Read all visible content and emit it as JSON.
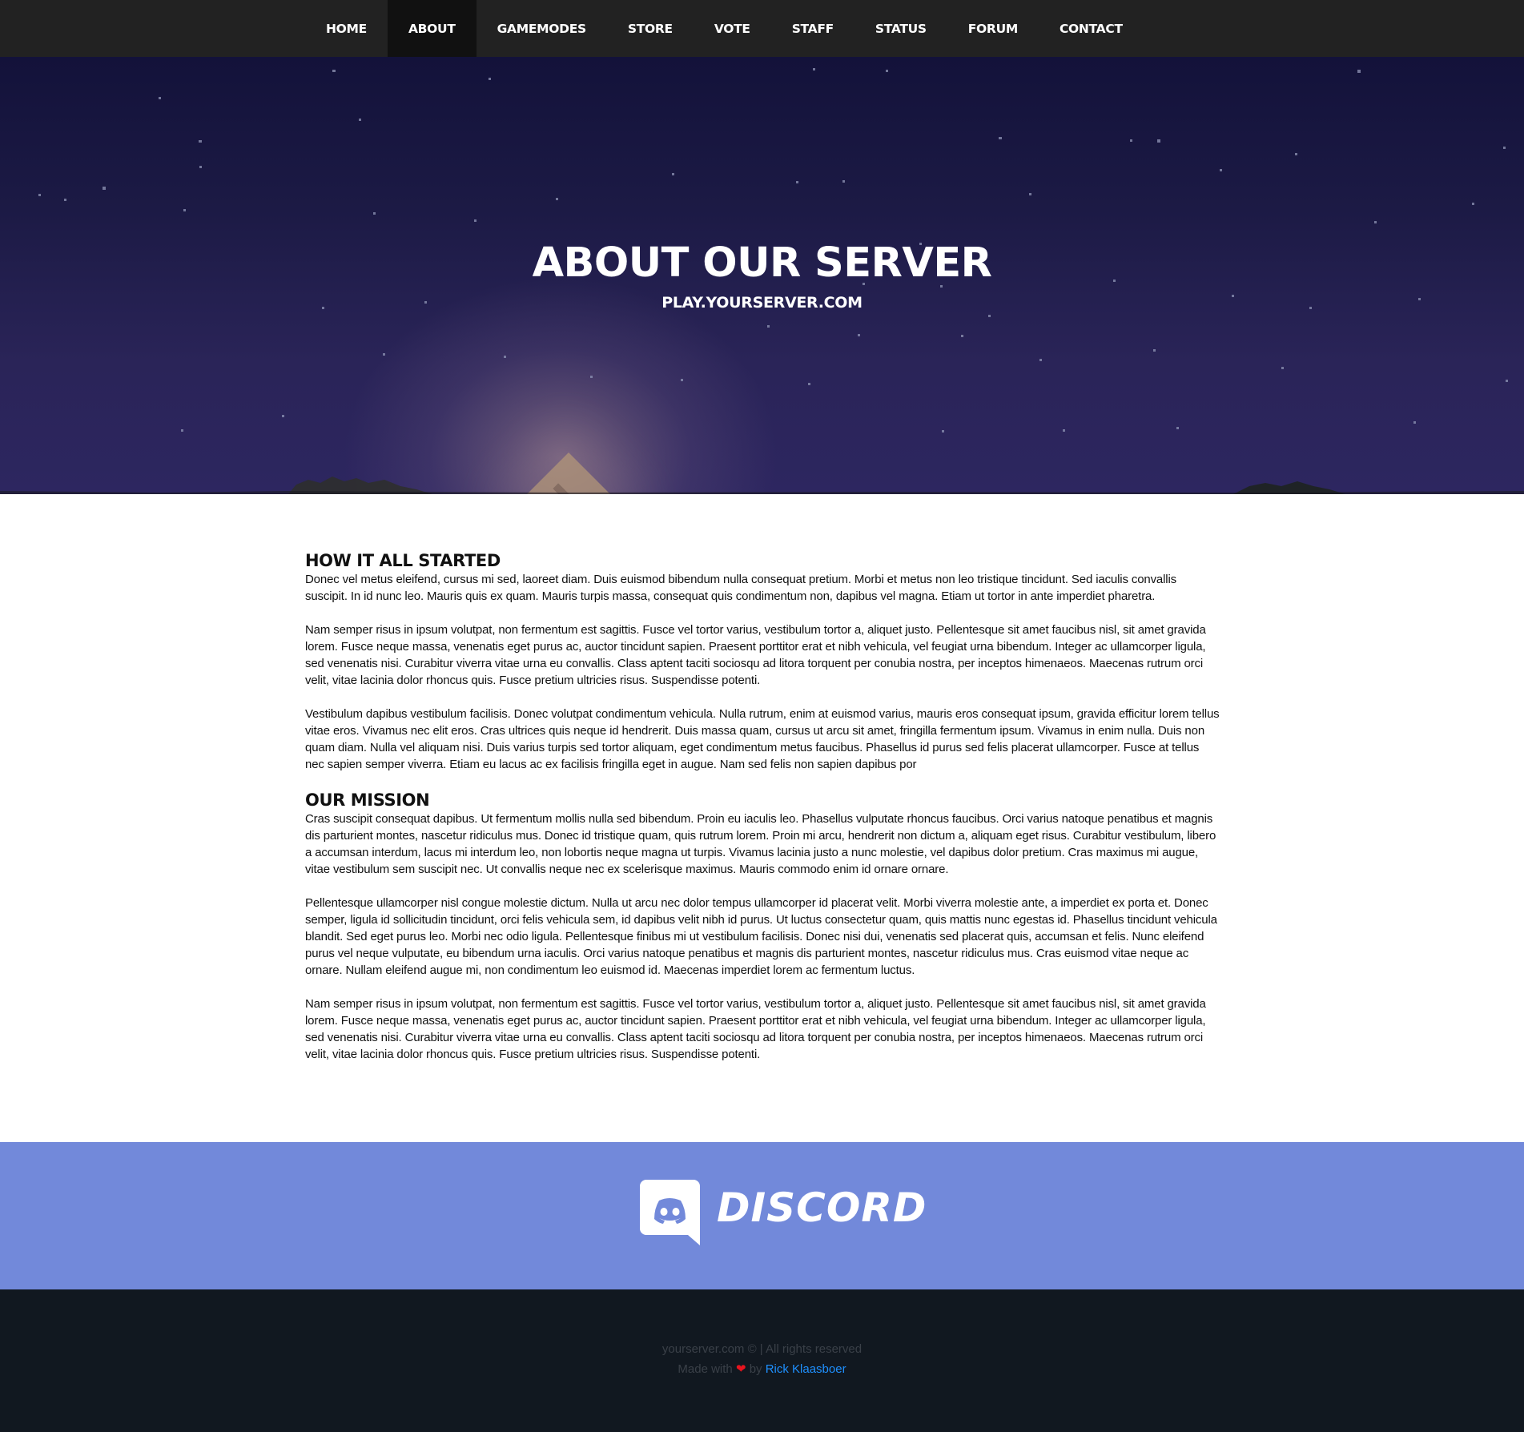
{
  "nav": {
    "items": [
      {
        "label": "HOME"
      },
      {
        "label": "ABOUT",
        "active": true
      },
      {
        "label": "GAMEMODES"
      },
      {
        "label": "STORE"
      },
      {
        "label": "VOTE"
      },
      {
        "label": "STAFF"
      },
      {
        "label": "STATUS"
      },
      {
        "label": "FORUM"
      },
      {
        "label": "CONTACT"
      }
    ]
  },
  "hero": {
    "title": "ABOUT OUR SERVER",
    "subtitle": "PLAY.YOURSERVER.COM"
  },
  "sections": [
    {
      "title": "HOW IT ALL STARTED",
      "paragraphs": [
        "Donec vel metus eleifend, cursus mi sed, laoreet diam. Duis euismod bibendum nulla consequat pretium. Morbi et metus non leo tristique tincidunt. Sed iaculis convallis suscipit. In id nunc leo. Mauris quis ex quam. Mauris turpis massa, consequat quis condimentum non, dapibus vel magna. Etiam ut tortor in ante imperdiet pharetra.",
        "Nam semper risus in ipsum volutpat, non fermentum est sagittis. Fusce vel tortor varius, vestibulum tortor a, aliquet justo. Pellentesque sit amet faucibus nisl, sit amet gravida lorem. Fusce neque massa, venenatis eget purus ac, auctor tincidunt sapien. Praesent porttitor erat et nibh vehicula, vel feugiat urna bibendum. Integer ac ullamcorper ligula, sed venenatis nisi. Curabitur viverra vitae urna eu convallis. Class aptent taciti sociosqu ad litora torquent per conubia nostra, per inceptos himenaeos. Maecenas rutrum orci velit, vitae lacinia dolor rhoncus quis. Fusce pretium ultricies risus. Suspendisse potenti.",
        "Vestibulum dapibus vestibulum facilisis. Donec volutpat condimentum vehicula. Nulla rutrum, enim at euismod varius, mauris eros consequat ipsum, gravida efficitur lorem tellus vitae eros. Vivamus nec elit eros. Cras ultrices quis neque id hendrerit. Duis massa quam, cursus ut arcu sit amet, fringilla fermentum ipsum. Vivamus in enim nulla. Duis non quam diam. Nulla vel aliquam nisi. Duis varius turpis sed tortor aliquam, eget condimentum metus faucibus. Phasellus id purus sed felis placerat ullamcorper. Fusce at tellus nec sapien semper viverra. Etiam eu lacus ac ex facilisis fringilla eget in augue. Nam sed felis non sapien dapibus por"
      ]
    },
    {
      "title": "OUR MISSION",
      "paragraphs": [
        "Cras suscipit consequat dapibus. Ut fermentum mollis nulla sed bibendum. Proin eu iaculis leo. Phasellus vulputate rhoncus faucibus. Orci varius natoque penatibus et magnis dis parturient montes, nascetur ridiculus mus. Donec id tristique quam, quis rutrum lorem. Proin mi arcu, hendrerit non dictum a, aliquam eget risus. Curabitur vestibulum, libero a accumsan interdum, lacus mi interdum leo, non lobortis neque magna ut turpis. Vivamus lacinia justo a nunc molestie, vel dapibus dolor pretium. Cras maximus mi augue, vitae vestibulum sem suscipit nec. Ut convallis neque nec ex scelerisque maximus. Mauris commodo enim id ornare ornare.",
        "Pellentesque ullamcorper nisl congue molestie dictum. Nulla ut arcu nec dolor tempus ullamcorper id placerat velit. Morbi viverra molestie ante, a imperdiet ex porta et. Donec semper, ligula id sollicitudin tincidunt, orci felis vehicula sem, id dapibus velit nibh id purus. Ut luctus consectetur quam, quis mattis nunc egestas id. Phasellus tincidunt vehicula blandit. Sed eget purus leo. Morbi nec odio ligula. Pellentesque finibus mi ut vestibulum facilisis. Donec nisi dui, venenatis sed placerat quis, accumsan et felis. Nunc eleifend purus vel neque vulputate, eu bibendum urna iaculis. Orci varius natoque penatibus et magnis dis parturient montes, nascetur ridiculus mus. Cras euismod vitae neque ac ornare. Nullam eleifend augue mi, non condimentum leo euismod id. Maecenas imperdiet lorem ac fermentum luctus.",
        "Nam semper risus in ipsum volutpat, non fermentum est sagittis. Fusce vel tortor varius, vestibulum tortor a, aliquet justo. Pellentesque sit amet faucibus nisl, sit amet gravida lorem. Fusce neque massa, venenatis eget purus ac, auctor tincidunt sapien. Praesent porttitor erat et nibh vehicula, vel feugiat urna bibendum. Integer ac ullamcorper ligula, sed venenatis nisi. Curabitur viverra vitae urna eu convallis. Class aptent taciti sociosqu ad litora torquent per conubia nostra, per inceptos himenaeos. Maecenas rutrum orci velit, vitae lacinia dolor rhoncus quis. Fusce pretium ultricies risus. Suspendisse potenti."
      ]
    }
  ],
  "discord": {
    "wordmark": "DISCORD",
    "icon": "discord-icon",
    "background": "#7289da"
  },
  "footer": {
    "copyright": "yourserver.com © | All rights reserved",
    "made_with": "Made with",
    "heart_icon": "heart-icon",
    "by": "by",
    "author": "Rick Klaasboer",
    "author_color": "#1e90ff"
  }
}
